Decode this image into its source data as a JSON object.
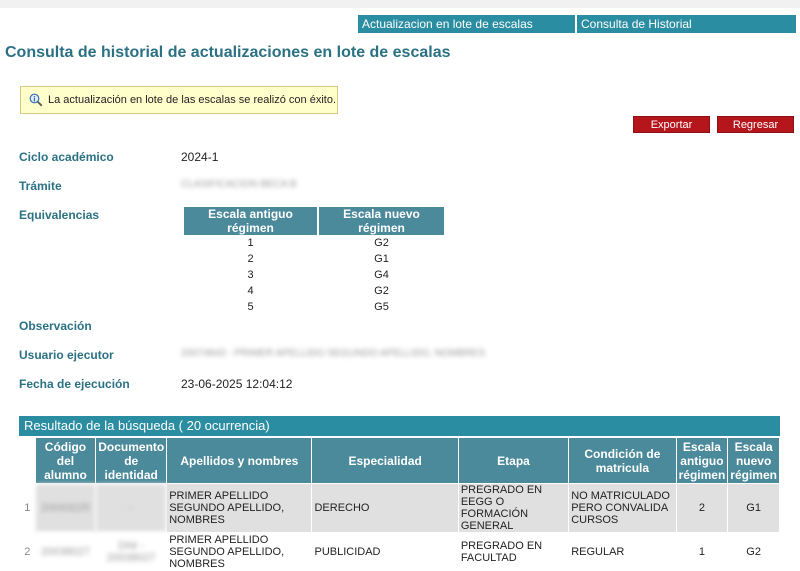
{
  "nav": {
    "tabs": [
      {
        "label": "Actualizacion en lote de escalas"
      },
      {
        "label": "Consulta de Historial"
      }
    ]
  },
  "page_title": "Consulta de historial de actualizaciones en lote de escalas",
  "alert": {
    "message": "La actualización en lote de las escalas se realizó con éxito."
  },
  "actions": {
    "export_label": "Exportar",
    "back_label": "Regresar"
  },
  "fields": {
    "ciclo": {
      "label": "Ciclo académico",
      "value": "2024-1"
    },
    "tramite": {
      "label": "Trámite",
      "value": "CLASIFICACION BECA B"
    },
    "equivalencias": {
      "label": "Equivalencias"
    },
    "observacion": {
      "label": "Observación",
      "value": ""
    },
    "usuario": {
      "label": "Usuario ejecutor",
      "value": "20074843 - PRIMER APELLIDO SEGUNDO APELLIDO, NOMBRES"
    },
    "fecha": {
      "label": "Fecha de ejecución",
      "value": "23-06-2025 12:04:12"
    }
  },
  "equivalences": {
    "headers": [
      "Escala antiguo régimen",
      "Escala nuevo régimen"
    ],
    "rows": [
      [
        "1",
        "G2"
      ],
      [
        "2",
        "G1"
      ],
      [
        "3",
        "G4"
      ],
      [
        "4",
        "G2"
      ],
      [
        "5",
        "G5"
      ]
    ]
  },
  "results": {
    "header": "Resultado de la búsqueda ( 20 ocurrencia)",
    "columns": [
      "Código del alumno",
      "Documento de identidad",
      "Apellidos y nombres",
      "Especialidad",
      "Etapa",
      "Condición de matricula",
      "Escala antiguo régimen",
      "Escala nuevo régimen"
    ],
    "rows": [
      {
        "index": "1",
        "codigo": "20043225",
        "documento": "-",
        "nombre": "PRIMER APELLIDO SEGUNDO APELLIDO, NOMBRES",
        "especialidad": "DERECHO",
        "etapa": "PREGRADO EN EEGG O FORMACIÓN GENERAL",
        "condicion": "NO MATRICULADO PERO CONVALIDA CURSOS",
        "antiguo": "2",
        "nuevo": "G1"
      },
      {
        "index": "2",
        "codigo": "20038027",
        "documento": "DNI - 20038027",
        "nombre": "PRIMER APELLIDO SEGUNDO APELLIDO, NOMBRES",
        "especialidad": "PUBLICIDAD",
        "etapa": "PREGRADO EN FACULTAD",
        "condicion": "REGULAR",
        "antiguo": "1",
        "nuevo": "G2"
      }
    ]
  },
  "colors": {
    "accent": "#2b8da1",
    "title": "#2b7184",
    "danger": "#b5161c",
    "alert_bg": "#ffffcc"
  },
  "icons": {
    "alert": "magnifier-info-icon"
  }
}
